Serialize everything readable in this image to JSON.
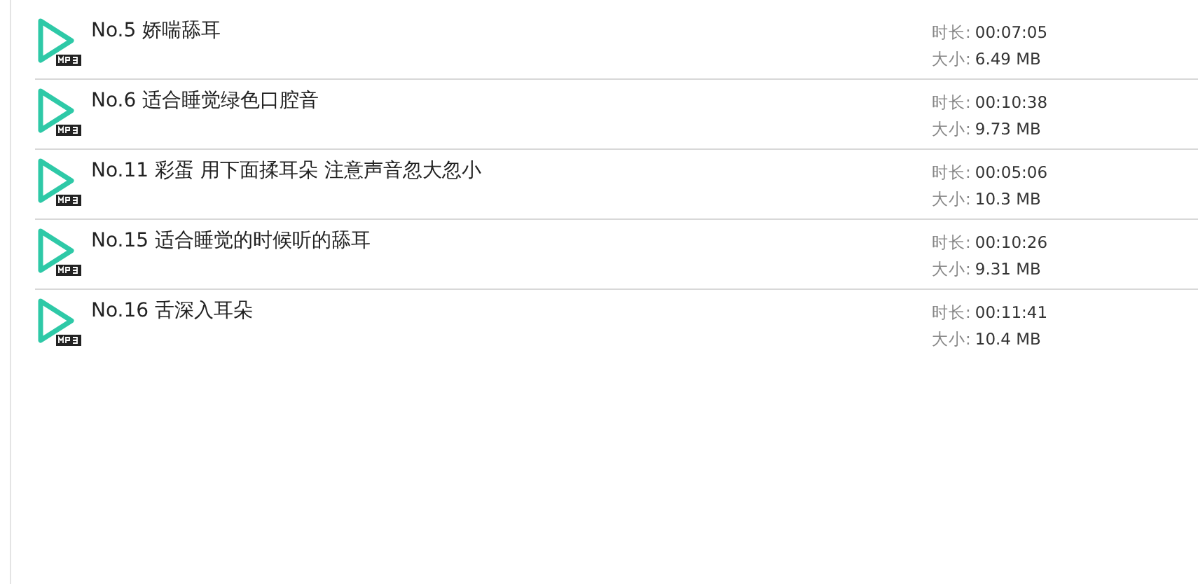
{
  "files": [
    {
      "title": "No.5 娇喘舔耳",
      "duration_label": "时长:",
      "duration": "00:07:05",
      "size_label": "大小:",
      "size": "6.49 MB"
    },
    {
      "title": "No.6 适合睡觉绿色口腔音",
      "duration_label": "时长:",
      "duration": "00:10:38",
      "size_label": "大小:",
      "size": "9.73 MB"
    },
    {
      "title": "No.11 彩蛋 用下面揉耳朵 注意声音忽大忽小",
      "duration_label": "时长:",
      "duration": "00:05:06",
      "size_label": "大小:",
      "size": "10.3 MB"
    },
    {
      "title": "No.15 适合睡觉的时候听的舔耳",
      "duration_label": "时长:",
      "duration": "00:10:26",
      "size_label": "大小:",
      "size": "9.31 MB"
    },
    {
      "title": "No.16 舌深入耳朵",
      "duration_label": "时长:",
      "duration": "00:11:41",
      "size_label": "大小:",
      "size": "10.4 MB"
    }
  ]
}
